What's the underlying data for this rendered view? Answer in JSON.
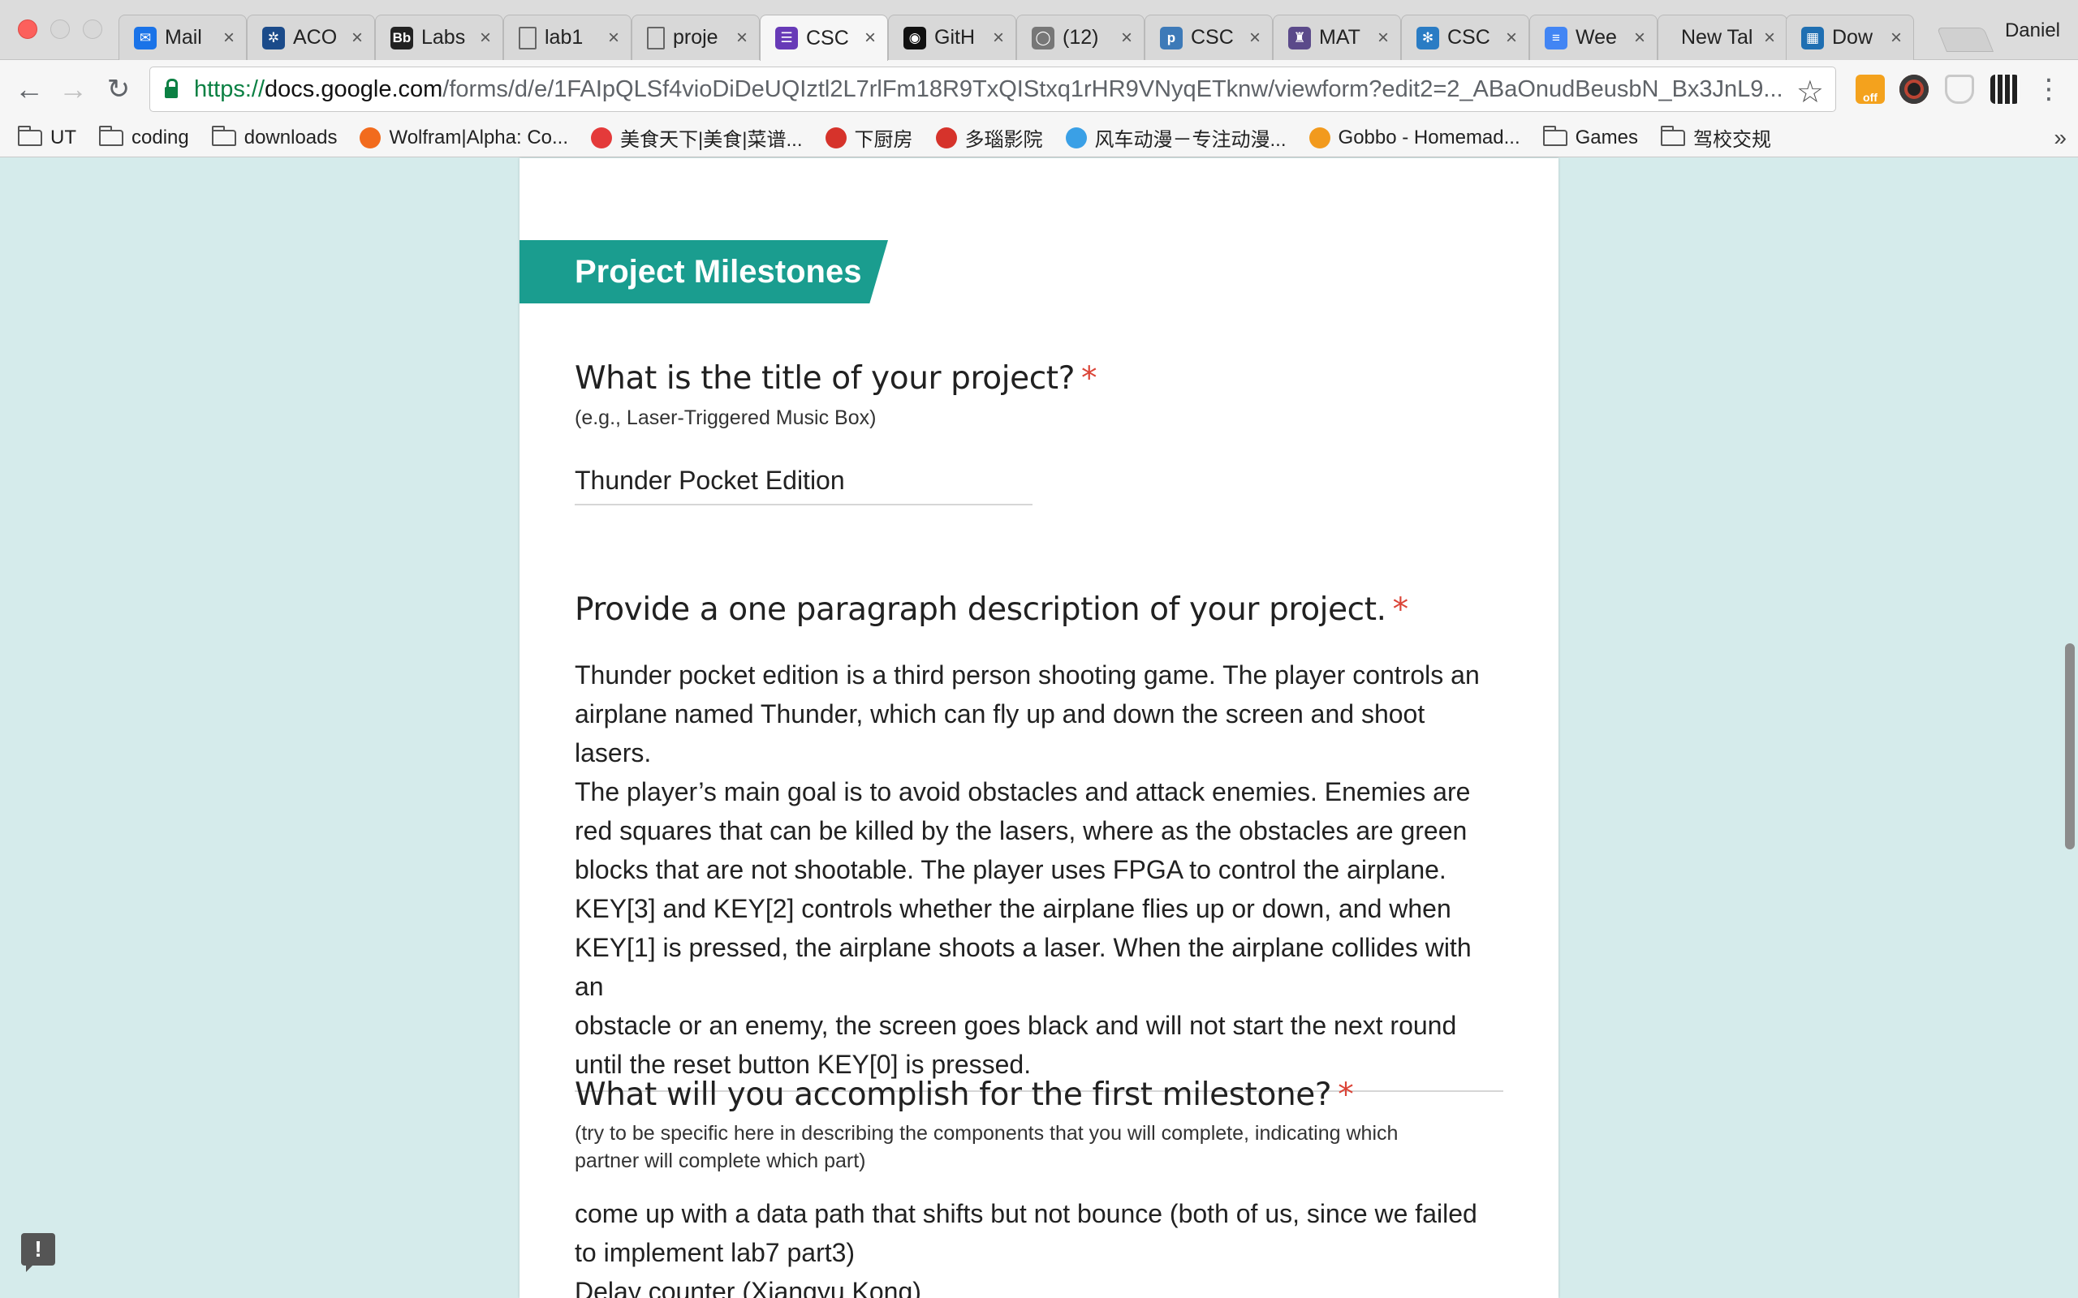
{
  "window": {
    "user": "Daniel"
  },
  "tabs": [
    {
      "label": "Mail",
      "icon": "mail-icon",
      "color": "#1a73e8",
      "glyph": "✉"
    },
    {
      "label": "ACO",
      "icon": "tree-icon",
      "color": "#1b4b8a",
      "glyph": "✲"
    },
    {
      "label": "Labs",
      "icon": "blackboard-icon",
      "color": "#222222",
      "glyph": "Bb"
    },
    {
      "label": "lab1",
      "icon": "document-icon",
      "color": "#ffffff",
      "glyph": ""
    },
    {
      "label": "proje",
      "icon": "document-icon",
      "color": "#ffffff",
      "glyph": ""
    },
    {
      "label": "CSC",
      "icon": "google-forms-icon",
      "color": "#673ab7",
      "glyph": "☰",
      "active": true
    },
    {
      "label": "GitH",
      "icon": "github-icon",
      "color": "#111111",
      "glyph": "◉"
    },
    {
      "label": "(12)",
      "icon": "chat-icon",
      "color": "#777777",
      "glyph": "◯"
    },
    {
      "label": "CSC",
      "icon": "piazza-icon",
      "color": "#3d7ab8",
      "glyph": "p"
    },
    {
      "label": "MAT",
      "icon": "crest-icon",
      "color": "#5b4a8a",
      "glyph": "♜"
    },
    {
      "label": "CSC",
      "icon": "snowflake-icon",
      "color": "#2a7cc4",
      "glyph": "✻"
    },
    {
      "label": "Wee",
      "icon": "google-docs-icon",
      "color": "#4285f4",
      "glyph": "≡"
    },
    {
      "label": "New Tal",
      "icon": "",
      "color": "",
      "glyph": ""
    },
    {
      "label": "Dow",
      "icon": "chart-icon",
      "color": "#1f6fb2",
      "glyph": "▦"
    }
  ],
  "toolbar": {
    "url_scheme": "https://",
    "url_host": "docs.google.com",
    "url_path": "/forms/d/e/1FAIpQLSf4vioDiDeUQIztl2L7rlFm18R9TxQIStxq1rHR9VNyqETknw/viewform?edit2=2_ABaOnudBeusbN_Bx3JnL9..."
  },
  "bookmarks": [
    {
      "label": "UT",
      "icon": "folder-icon"
    },
    {
      "label": "coding",
      "icon": "folder-icon"
    },
    {
      "label": "downloads",
      "icon": "folder-icon"
    },
    {
      "label": "Wolfram|Alpha: Co...",
      "icon": "wolfram-icon",
      "color": "#f26b1d"
    },
    {
      "label": "美食天下|美食|菜谱...",
      "icon": "food-icon",
      "color": "#e43a3a"
    },
    {
      "label": "下厨房",
      "icon": "kitchen-icon",
      "color": "#d6332b"
    },
    {
      "label": "多瑙影院",
      "icon": "video-icon",
      "color": "#d6332b"
    },
    {
      "label": "风车动漫－专注动漫...",
      "icon": "pinwheel-icon",
      "color": "#3aa0e6"
    },
    {
      "label": "Gobbo - Homemad...",
      "icon": "gobbo-icon",
      "color": "#f29a1d"
    },
    {
      "label": "Games",
      "icon": "folder-icon"
    },
    {
      "label": "驾校交规",
      "icon": "folder-icon"
    }
  ],
  "form": {
    "section_title": "Project Milestones",
    "required_mark": "*",
    "q1": {
      "title": "What is the title of your project?",
      "help": "(e.g., Laser-Triggered Music Box)",
      "answer": "Thunder Pocket Edition"
    },
    "q2": {
      "title": "Provide a one paragraph description of your project.",
      "answer": "Thunder pocket edition is a third person shooting game. The player controls an\nairplane named Thunder, which can fly up and down the screen and shoot lasers.\nThe player’s main goal is to avoid obstacles and attack enemies. Enemies are\nred squares that can be killed by the lasers, where as the obstacles are green\nblocks that are not shootable. The player uses FPGA to control the airplane.\nKEY[3] and KEY[2] controls whether the airplane flies up or down, and when\nKEY[1] is pressed, the airplane shoots a laser. When the airplane collides with an\nobstacle or an enemy, the screen goes black and will not start the next round\nuntil the reset button KEY[0] is pressed."
    },
    "q3": {
      "title": "What will you accomplish for the first milestone?",
      "help": "(try to be specific here in describing the components that you will complete, indicating which\npartner will complete which part)",
      "answer": "come up with a data path that shifts but not bounce (both of us, since we failed\nto implement lab7 part3)\nDelay counter (Xiangyu Kong)"
    }
  },
  "colors": {
    "accent": "#1a9d8f",
    "page_background": "#d5ebeb",
    "required": "#db4437"
  }
}
